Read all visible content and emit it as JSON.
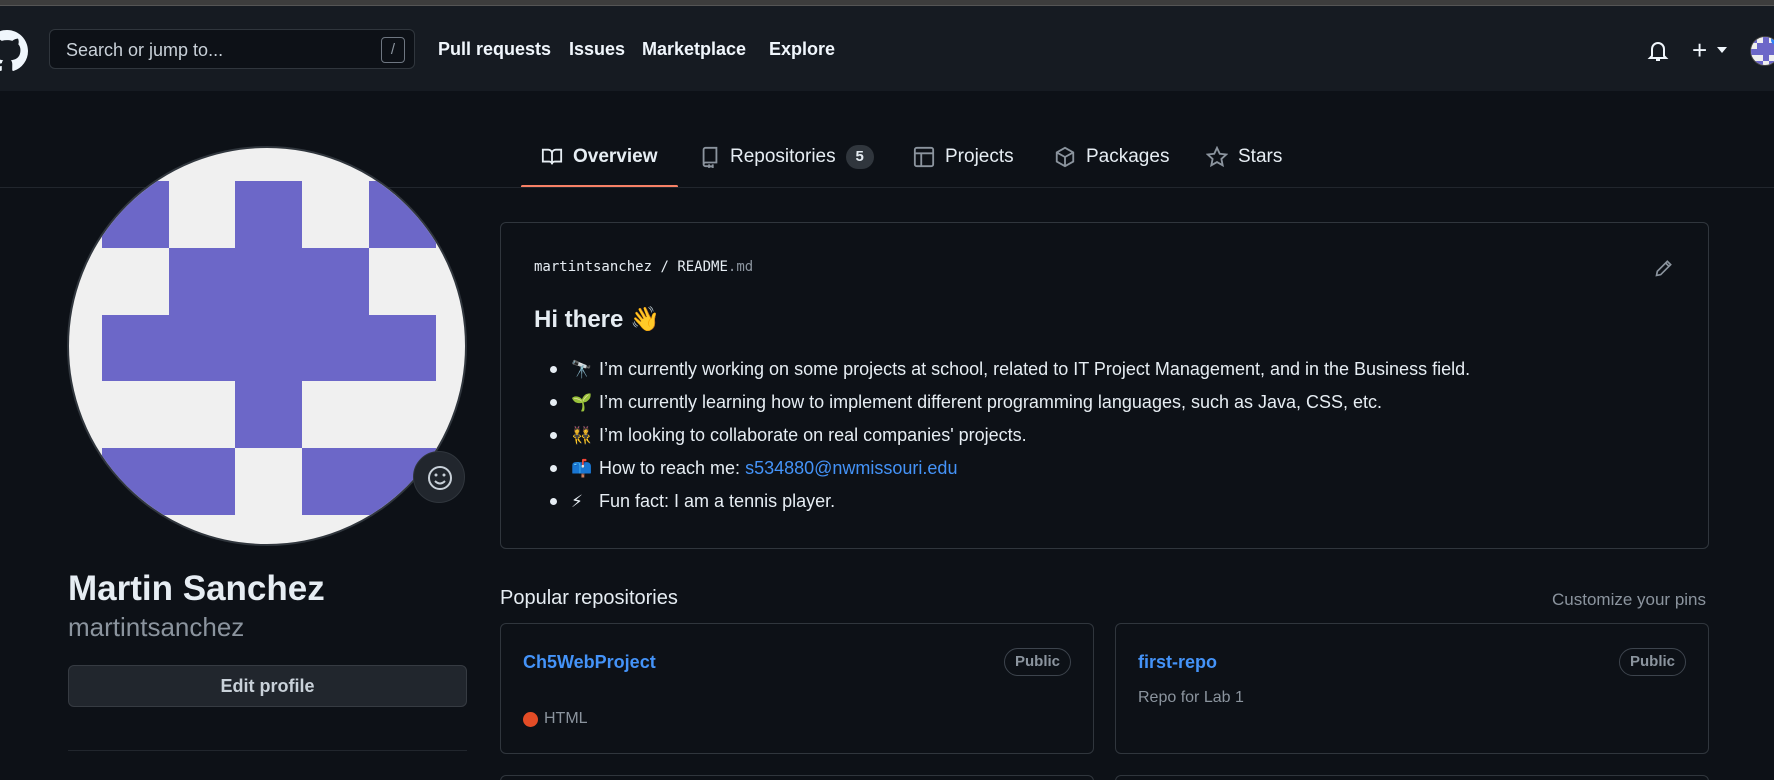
{
  "header": {
    "search_placeholder": "Search or jump to...",
    "search_shortcut": "/",
    "nav": [
      "Pull requests",
      "Issues",
      "Marketplace",
      "Explore"
    ],
    "plus": "+"
  },
  "tabs": {
    "overview": "Overview",
    "repositories": "Repositories",
    "repositories_count": "5",
    "projects": "Projects",
    "packages": "Packages",
    "stars": "Stars"
  },
  "profile": {
    "full_name": "Martin Sanchez",
    "username": "martintsanchez",
    "edit_label": "Edit profile",
    "avatar_color": "#6c67c8"
  },
  "readme": {
    "owner": "martintsanchez",
    "separator": "/",
    "file_base": "README",
    "file_ext": ".md",
    "title": "Hi there 👋",
    "items": [
      {
        "icon": "🔭",
        "text": "I’m currently working on some projects at school, related to IT Project Management, and in the Business field."
      },
      {
        "icon": "🌱",
        "text": "I’m currently learning how to implement different programming languages, such as Java, CSS, etc."
      },
      {
        "icon": "👯",
        "text": "I’m looking to collaborate on real companies' projects."
      },
      {
        "icon": "📫",
        "text": "How to reach me:",
        "link": "s534880@nwmissouri.edu"
      },
      {
        "icon": "⚡",
        "text": "Fun fact: I am a tennis player."
      }
    ]
  },
  "popular": {
    "title": "Popular repositories",
    "customize": "Customize your pins",
    "repos": [
      {
        "name": "Ch5WebProject",
        "visibility": "Public",
        "description": "",
        "language": "HTML",
        "language_color": "#e34c26"
      },
      {
        "name": "first-repo",
        "visibility": "Public",
        "description": "Repo for Lab 1",
        "language": "",
        "language_color": ""
      }
    ]
  }
}
